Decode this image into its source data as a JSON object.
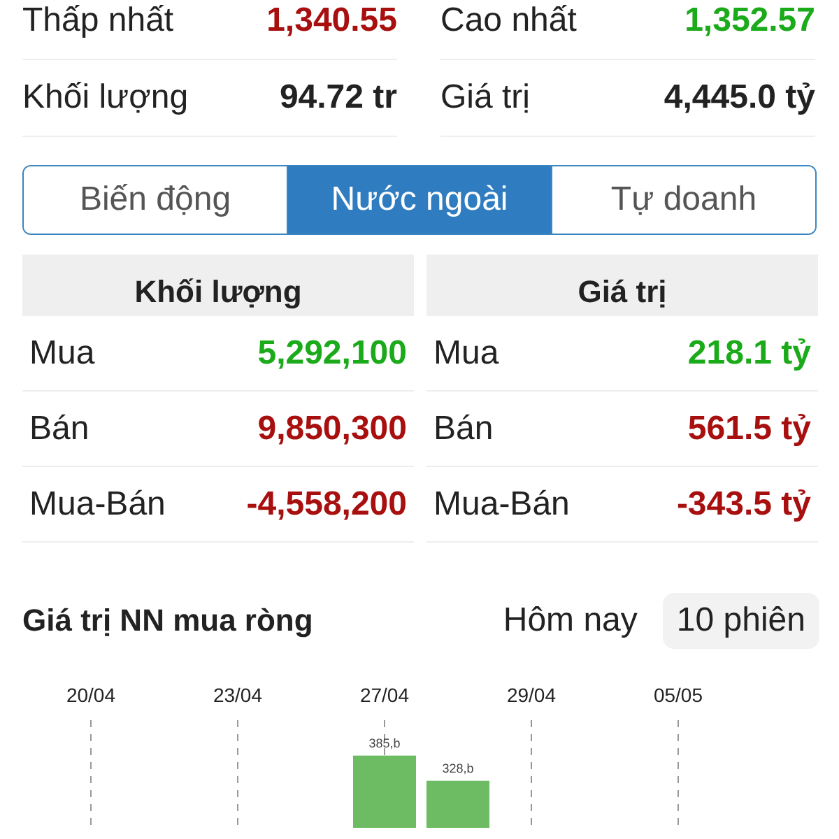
{
  "stats": [
    {
      "label": "Thấp nhất",
      "value": "1,340.55",
      "color": "#a80f0f"
    },
    {
      "label": "Cao nhất",
      "value": "1,352.57",
      "color": "#1aaa1a"
    },
    {
      "label": "Khối lượng",
      "value": "94.72 tr",
      "color": "#222222"
    },
    {
      "label": "Giá trị",
      "value": "4,445.0 tỷ",
      "color": "#222222"
    }
  ],
  "tabs": [
    {
      "label": "Biến động",
      "selected": false
    },
    {
      "label": "Nước ngoài",
      "selected": true
    },
    {
      "label": "Tự doanh",
      "selected": false
    }
  ],
  "trade_table": {
    "columns": [
      "Khối lượng",
      "Giá trị"
    ],
    "rows": [
      {
        "volume_label": "Mua",
        "volume": "5,292,100",
        "value_label": "Mua",
        "value": "218.1 tỷ",
        "color": "#1aaa1a"
      },
      {
        "volume_label": "Bán",
        "volume": "9,850,300",
        "value_label": "Bán",
        "value": "561.5 tỷ",
        "color": "#a80f0f"
      },
      {
        "volume_label": "Mua-Bán",
        "volume": "-4,558,200",
        "value_label": "Mua-Bán",
        "value": "-343.5 tỷ",
        "color": "#a80f0f"
      }
    ]
  },
  "net_buy": {
    "title": "Giá trị NN mua ròng",
    "periods": [
      {
        "label": "Hôm nay",
        "selected": false
      },
      {
        "label": "10 phiên",
        "selected": true
      }
    ],
    "chart_data": {
      "type": "bar",
      "categories": [
        "20/04",
        null,
        "23/04",
        null,
        "27/04",
        null,
        "29/04",
        null,
        "05/05",
        null
      ],
      "values": [
        null,
        null,
        null,
        null,
        385,
        328,
        null,
        null,
        null,
        null
      ],
      "value_labels": [
        null,
        null,
        null,
        null,
        "385,b",
        "328,b",
        null,
        null,
        null,
        null
      ]
    }
  }
}
